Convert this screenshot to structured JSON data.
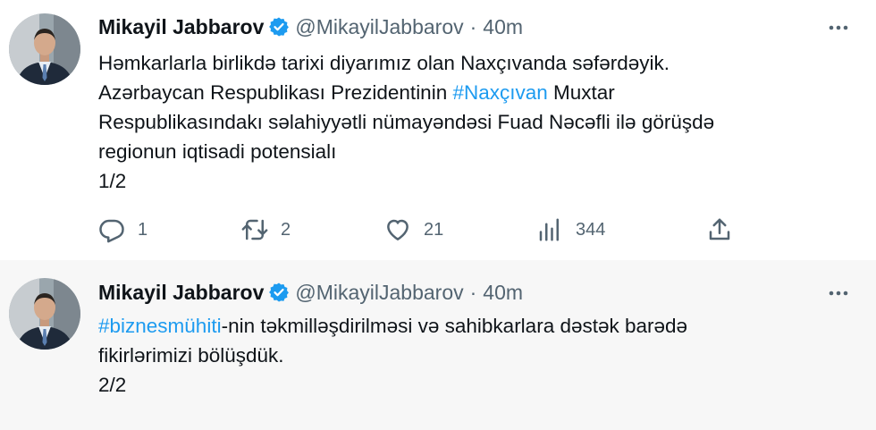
{
  "thread": {
    "tweets": [
      {
        "author": {
          "name": "Mikayil Jabbarov",
          "handle": "@MikayilJabbarov",
          "separator": "·",
          "time": "40m",
          "verified": true,
          "avatar_icon": "profile-photo"
        },
        "text": {
          "line1": "Həmkarlarla birlikdə tarixi diyarımız olan Naxçıvanda səfərdəyik.",
          "line2_before": "Azərbaycan Respublikası Prezidentinin ",
          "line2_hashtag": "#Naxçıvan",
          "line2_after": " Muxtar",
          "line3": "Respublikasındakı səlahiyyətli nümayəndəsi Fuad Nəcəfli ilə görüşdə",
          "line4": "regionun iqtisadi potensialı",
          "line5": "1/2"
        },
        "metrics": {
          "replies": "1",
          "retweets": "2",
          "likes": "21",
          "views": "344"
        }
      },
      {
        "author": {
          "name": "Mikayil Jabbarov",
          "handle": "@MikayilJabbarov",
          "separator": "·",
          "time": "40m",
          "verified": true,
          "avatar_icon": "profile-photo"
        },
        "text": {
          "line1_hashtag": "#biznesmühiti",
          "line1_after": "-nin təkmilləşdirilməsi və sahibkarlara dəstək barədə",
          "line2": "fikirlərimizi bölüşdük.",
          "line3": "2/2"
        }
      }
    ]
  },
  "colors": {
    "accent": "#1d9bf0",
    "text_primary": "#0f1419",
    "text_secondary": "#536471",
    "thread_line": "#cfd9de",
    "second_tweet_bg": "#f7f7f7"
  },
  "icons": [
    "verified-badge-icon",
    "more-options-icon",
    "reply-icon",
    "retweet-icon",
    "like-icon",
    "views-icon",
    "share-icon"
  ]
}
